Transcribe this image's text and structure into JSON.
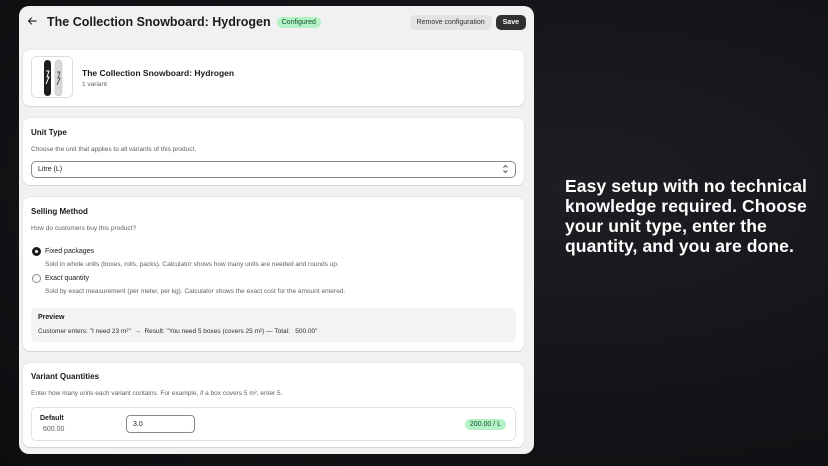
{
  "header": {
    "back_icon": "arrow-left-icon",
    "title": "The Collection Snowboard: Hydrogen",
    "status_badge": "Configured",
    "remove_label": "Remove configuration",
    "save_label": "Save"
  },
  "product": {
    "title": "The Collection Snowboard: Hydrogen",
    "subtitle": "1 variant",
    "image_icon": "snowboard-image"
  },
  "unit_type": {
    "heading": "Unit Type",
    "help": "Choose the unit that applies to all variants of this product.",
    "selected": "Litre (L)",
    "chevron_icon": "select-arrows-icon"
  },
  "selling_method": {
    "heading": "Selling Method",
    "help": "How do customers buy this product?",
    "options": [
      {
        "label": "Fixed packages",
        "description": "Sold in whole units (boxes, rolls, packs). Calculator shows how many units are needed and rounds up.",
        "selected": true
      },
      {
        "label": "Exact quantity",
        "description": "Sold by exact measurement (per meter, per kg). Calculator shows the exact cost for the amount entered.",
        "selected": false
      }
    ],
    "preview": {
      "heading": "Preview",
      "text": "Customer enters: \"I need 23 m²\"  →  Result: \"You need 5 boxes (covers 25 m²) — Total:   500.00\""
    }
  },
  "variant_quantities": {
    "heading": "Variant Quantities",
    "help": "Enter how many units each variant contains. For example, if a box covers 5 m², enter 5.",
    "rows": [
      {
        "name": "Default",
        "price": "600.00",
        "quantity": "3.0",
        "unit_price": "200.00 / L"
      }
    ]
  },
  "promo": {
    "text": "Easy setup with no technical knowledge required. Choose your unit type, enter the quantity, and you are done."
  },
  "colors": {
    "success_bg": "#b4f2c6",
    "success_text": "#0c5132",
    "primary_button": "#303030",
    "page_bg": "#f1f1f1"
  }
}
